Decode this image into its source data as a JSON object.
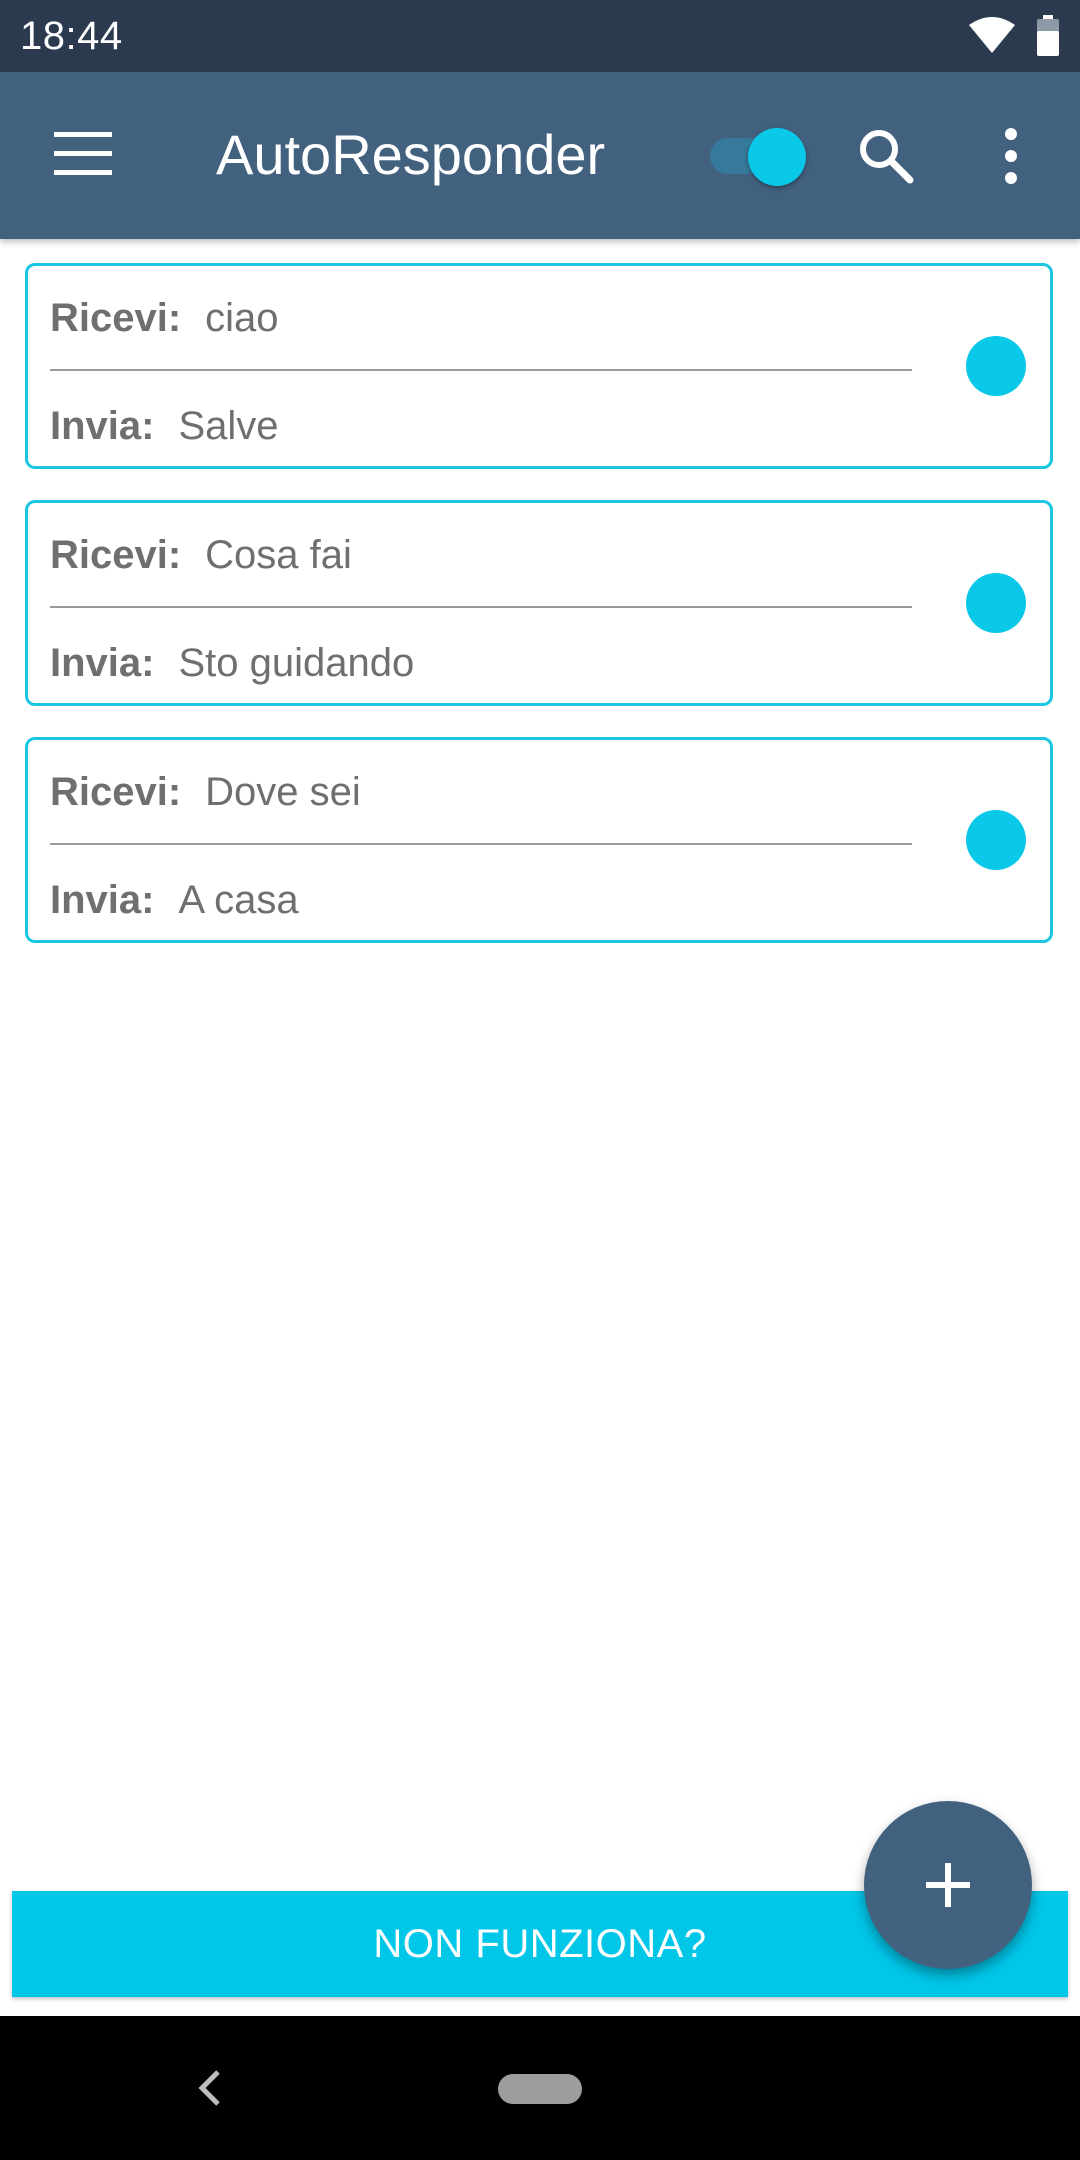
{
  "status_bar": {
    "time": "18:44",
    "icons": [
      "wifi-icon",
      "battery-icon"
    ]
  },
  "app_bar": {
    "title": "AutoResponder",
    "service_toggle_on": true,
    "icons": [
      "menu-icon",
      "search-icon",
      "more-vert-icon"
    ]
  },
  "rules": [
    {
      "receive_label": "Ricevi:",
      "receive": "ciao",
      "send_label": "Invia:",
      "send": "Salve",
      "enabled": true
    },
    {
      "receive_label": "Ricevi:",
      "receive": "Cosa fai",
      "send_label": "Invia:",
      "send": "Sto guidando",
      "enabled": true
    },
    {
      "receive_label": "Ricevi:",
      "receive": "Dove sei",
      "send_label": "Invia:",
      "send": "A casa",
      "enabled": true
    }
  ],
  "help_button": {
    "label": "NON FUNZIONA?"
  },
  "fab": {
    "icon": "plus-icon"
  },
  "colors": {
    "status_bar": "#2b3a4f",
    "app_bar": "#42617f",
    "accent": "#00c6e8",
    "card_border": "#1bc6e3",
    "text_gray": "#6f6f6f"
  },
  "nav_bar": {
    "icons": [
      "back-icon",
      "home-pill"
    ]
  }
}
